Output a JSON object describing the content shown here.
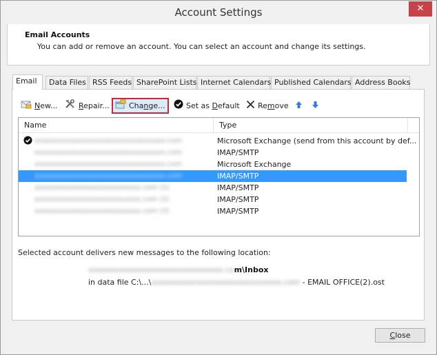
{
  "window": {
    "title": "Account Settings",
    "close_glyph": "✕"
  },
  "header": {
    "title": "Email Accounts",
    "description": "You can add or remove an account. You can select an account and change its settings."
  },
  "tabs": [
    {
      "label": "Email",
      "active": true
    },
    {
      "label": "Data Files",
      "active": false
    },
    {
      "label": "RSS Feeds",
      "active": false
    },
    {
      "label": "SharePoint Lists",
      "active": false
    },
    {
      "label": "Internet Calendars",
      "active": false
    },
    {
      "label": "Published Calendars",
      "active": false
    },
    {
      "label": "Address Books",
      "active": false
    }
  ],
  "toolbar": {
    "new": {
      "pre": "",
      "u": "N",
      "post": "ew..."
    },
    "repair": {
      "pre": "",
      "u": "R",
      "post": "epair..."
    },
    "change": {
      "pre": "Cha",
      "u": "n",
      "post": "ge..."
    },
    "set_default": {
      "pre": "Set as ",
      "u": "D",
      "post": "efault"
    },
    "remove": {
      "pre": "Re",
      "u": "m",
      "post": "ove"
    },
    "move_up_icon": "arrow-up-icon",
    "move_down_icon": "arrow-down-icon"
  },
  "accounts_list": {
    "columns": [
      "Name",
      "Type"
    ],
    "rows": [
      {
        "name": "xxxxxxxxxxxxxxxxxxxxxxxxxxxxxxxx.com",
        "type": "Microsoft Exchange (send from this account by def...",
        "default": true,
        "selected": false
      },
      {
        "name": "xxxxxxxxxxxxxxxxxxxxxxxxxxxxxxxx.com",
        "type": "IMAP/SMTP",
        "default": false,
        "selected": false
      },
      {
        "name": "xxxxxxxxxxxxxxxxxxxxxxxxxxxxxxxx.com",
        "type": "Microsoft Exchange",
        "default": false,
        "selected": false
      },
      {
        "name": "xxxxxxxxxxxxxxxxxxxxxxxxxxxxxxxx.com",
        "type": "IMAP/SMTP",
        "default": false,
        "selected": true
      },
      {
        "name": "xxxxxxxxxxxxxxxxxxxxxxxxxx.com (1)",
        "type": "IMAP/SMTP",
        "default": false,
        "selected": false
      },
      {
        "name": "xxxxxxxxxxxxxxxxxxxxxxxxxx.com (2)",
        "type": "IMAP/SMTP",
        "default": false,
        "selected": false
      },
      {
        "name": "xxxxxxxxxxxxxxxxxxxxxxxxxx.com (3)",
        "type": "IMAP/SMTP",
        "default": false,
        "selected": false
      }
    ]
  },
  "delivery": {
    "label": "Selected account delivers new messages to the following location:",
    "folder_blurred": "xxxxxxxxxxxxxxxxxxxxxxxxxxxxxx.co",
    "folder_suffix": "m\\Inbox",
    "file_prefix": "in data file C:\\...\\",
    "file_blurred": "xxxxxxxxxxxxxxxxxxxxxxxxxxxxx.com",
    "file_suffix": " - EMAIL OFFICE(2).ost"
  },
  "footer": {
    "close": {
      "pre": "",
      "u": "C",
      "post": "lose"
    }
  },
  "colors": {
    "selection": "#3399ff",
    "highlight_border": "#c3283a",
    "close_red": "#c7434b",
    "arrow_blue": "#3a7bd5"
  }
}
